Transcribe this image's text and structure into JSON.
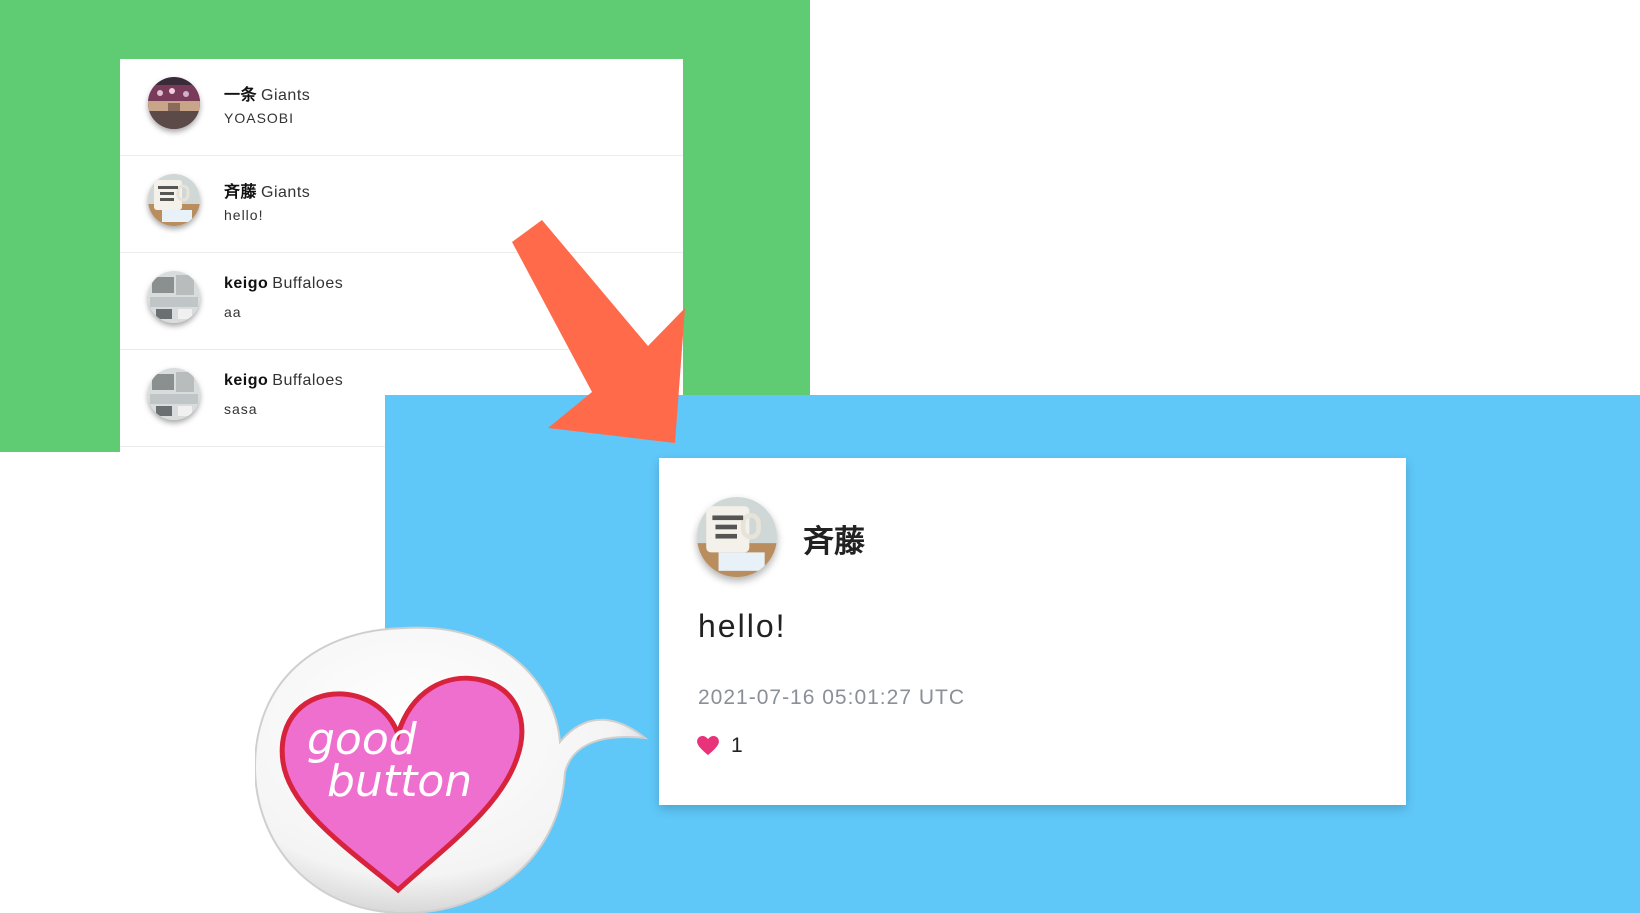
{
  "list": {
    "items": [
      {
        "name": "一条",
        "team": "Giants",
        "message": "YOASOBI",
        "avatar": "stadium-photo"
      },
      {
        "name": "斉藤",
        "team": "Giants",
        "message": "hello!",
        "avatar": "mug-photo"
      },
      {
        "name": "keigo",
        "team": "Buffaloes",
        "message": "aa",
        "avatar": "desk-photo"
      },
      {
        "name": "keigo",
        "team": "Buffaloes",
        "message": "sasa",
        "avatar": "desk-photo"
      }
    ]
  },
  "post": {
    "author": "斉藤",
    "body": "hello!",
    "timestamp": "2021-07-16 05:01:27 UTC",
    "like_count": "1",
    "avatar": "mug-photo"
  },
  "callout": {
    "line1": "good",
    "line2": "button",
    "icon": "heart-icon"
  },
  "colors": {
    "green_panel": "#5fcc73",
    "blue_panel": "#5fc8f9",
    "arrow": "#ff6b4a",
    "heart_like": "#e8327a",
    "heart_callout": "#ef6fcf"
  }
}
